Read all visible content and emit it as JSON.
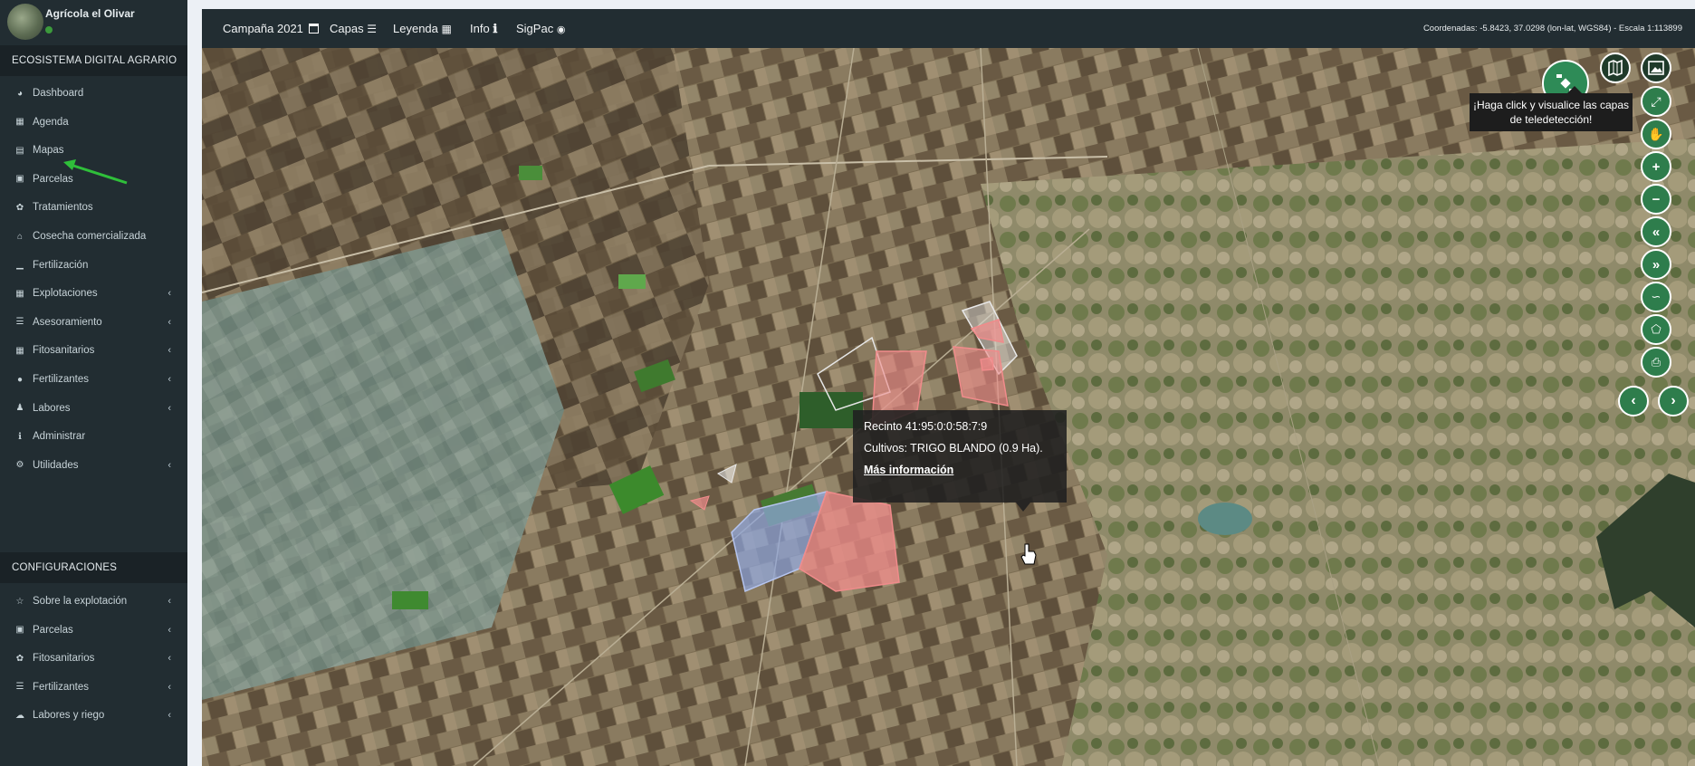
{
  "sidebar": {
    "user_name": "Agrícola el Olivar",
    "section_main": "ECOSISTEMA DIGITAL AGRARIO",
    "items": [
      {
        "label": "Dashboard",
        "icon": "dashboard-icon"
      },
      {
        "label": "Agenda",
        "icon": "table-icon"
      },
      {
        "label": "Mapas",
        "icon": "map-icon"
      },
      {
        "label": "Parcelas",
        "icon": "image-icon"
      },
      {
        "label": "Tratamientos",
        "icon": "leaf-icon"
      },
      {
        "label": "Cosecha comercializada",
        "icon": "home-icon"
      },
      {
        "label": "Fertilización",
        "icon": "bar-chart-icon"
      },
      {
        "label": "Explotaciones",
        "icon": "table-icon"
      },
      {
        "label": "Asesoramiento",
        "icon": "list-icon"
      },
      {
        "label": "Fitosanitarios",
        "icon": "grid-icon"
      },
      {
        "label": "Fertilizantes",
        "icon": "circle-icon"
      },
      {
        "label": "Labores",
        "icon": "user-icon"
      },
      {
        "label": "Administrar",
        "icon": "info-icon"
      },
      {
        "label": "Utilidades",
        "icon": "cogs-icon"
      }
    ],
    "section_config": "CONFIGURACIONES",
    "config_items": [
      {
        "label": "Sobre la explotación",
        "icon": "star-icon"
      },
      {
        "label": "Parcelas",
        "icon": "image-icon"
      },
      {
        "label": "Fitosanitarios",
        "icon": "leaf-icon"
      },
      {
        "label": "Fertilizantes",
        "icon": "list-icon"
      },
      {
        "label": "Labores y riego",
        "icon": "cloud-icon"
      }
    ]
  },
  "topbar": {
    "campaign": "Campaña 2021",
    "layers": "Capas",
    "legend": "Leyenda",
    "info": "Info",
    "sigpac": "SigPac",
    "coords": "Coordenadas: -5.8423, 37.0298 (lon-lat, WGS84) - Escala 1:113899"
  },
  "popup": {
    "recinto": "Recinto 41:95:0:0:58:7:9",
    "cultivos": "Cultivos: TRIGO BLANDO (0.9 Ha).",
    "more": "Más información"
  },
  "hint": "¡Haga click y visualice las capas de teledetección!",
  "colors": {
    "sidebar_bg": "#222d32",
    "accent_green": "#2e8b57",
    "parcel_pink": "#f08b8b",
    "parcel_blue": "#8fa6e0"
  }
}
